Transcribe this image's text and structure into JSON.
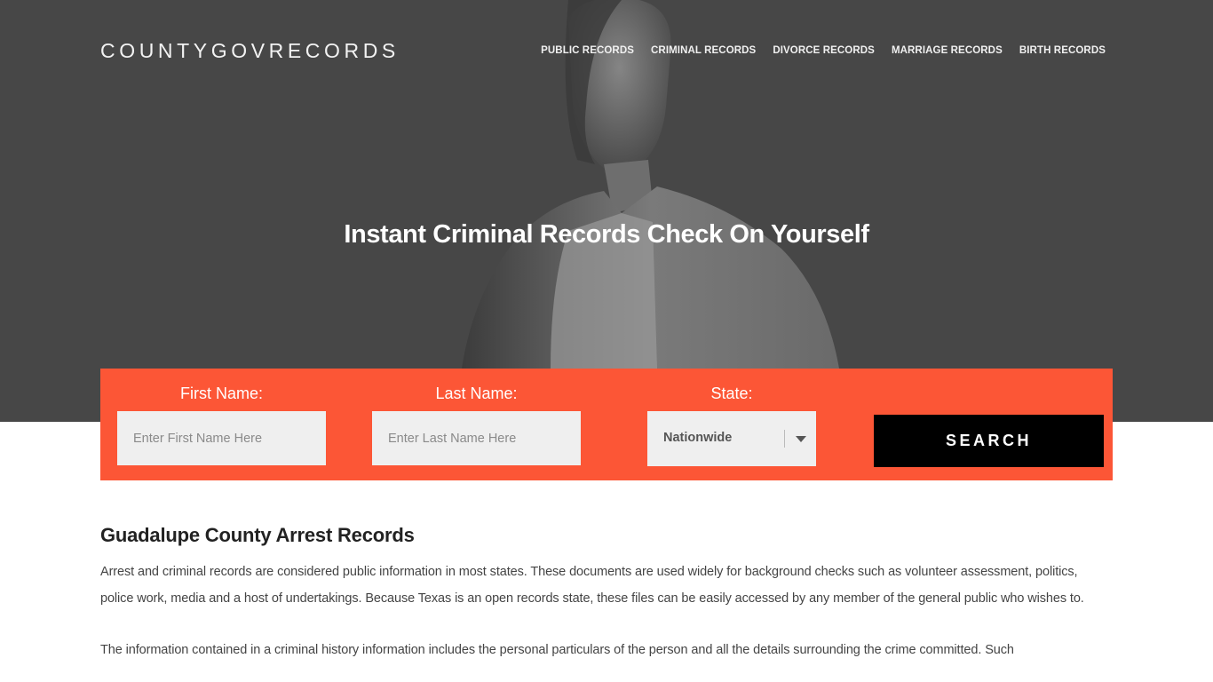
{
  "header": {
    "logo": "COUNTYGOVRECORDS",
    "nav": [
      {
        "label": "PUBLIC RECORDS"
      },
      {
        "label": "CRIMINAL RECORDS"
      },
      {
        "label": "DIVORCE RECORDS"
      },
      {
        "label": "MARRIAGE RECORDS"
      },
      {
        "label": "BIRTH RECORDS"
      }
    ]
  },
  "hero": {
    "title": "Instant Criminal Records Check On Yourself",
    "image_icon": "person-photo"
  },
  "search_form": {
    "first_name": {
      "label": "First Name:",
      "placeholder": "Enter First Name Here",
      "value": ""
    },
    "last_name": {
      "label": "Last Name:",
      "placeholder": "Enter Last Name Here",
      "value": ""
    },
    "state": {
      "label": "State:",
      "selected": "Nationwide"
    },
    "submit_label": "SEARCH"
  },
  "colors": {
    "accent": "#fc5636",
    "hero_bg": "#474747",
    "button_bg": "#000000",
    "input_bg": "#efefef"
  },
  "article": {
    "heading": "Guadalupe County Arrest Records",
    "paragraphs": [
      "Arrest and criminal records are considered public information in most states. These documents are used widely for background checks such as volunteer assessment, politics, police work, media and a host of undertakings. Because Texas is an open records state, these files can be easily accessed by any member of the general public who wishes to.",
      "The information contained in a criminal history information includes the personal particulars of the person and all the details surrounding the crime committed. Such"
    ]
  }
}
